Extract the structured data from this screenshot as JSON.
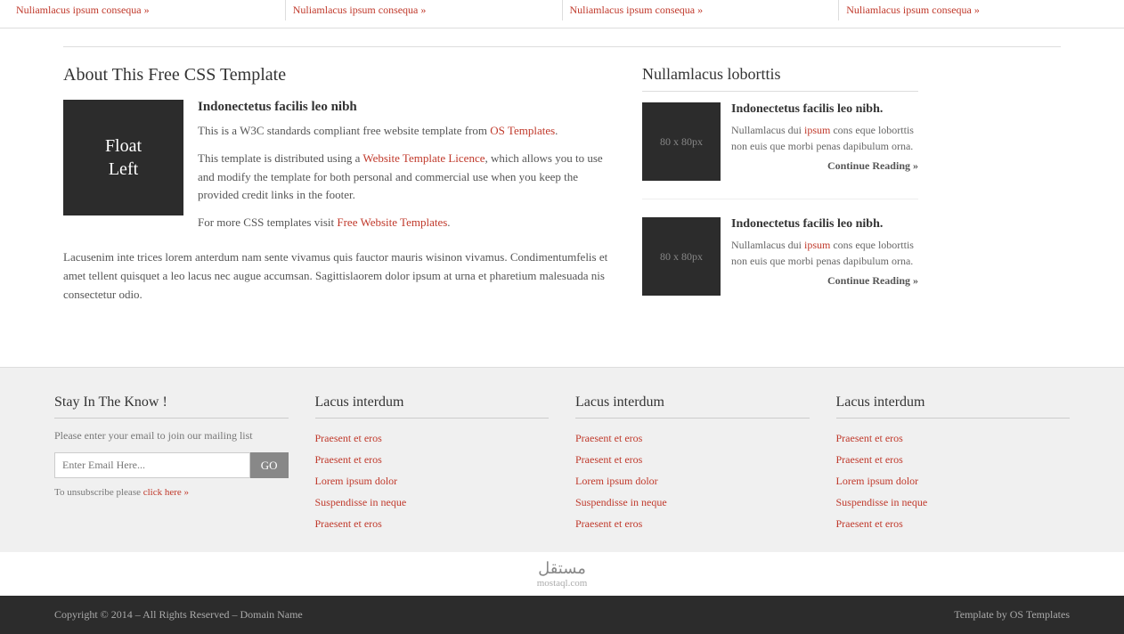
{
  "top_strip": {
    "items": [
      "Nuliamlacus ipsum consequa »",
      "Nuliamlacus ipsum consequa »",
      "Nuliamlacus ipsum consequa »",
      "Nuliamlacus ipsum consequa »"
    ]
  },
  "left_section": {
    "title": "About This Free CSS Template",
    "float_left": {
      "line1": "Float",
      "line2": "Left"
    },
    "article_title": "Indonectetus facilis leo nibh",
    "paragraph1": "This is a W3C standards compliant free website template from OS Templates.",
    "paragraph1_link1": "OS Templates",
    "paragraph2_before": "This template is distributed using a ",
    "paragraph2_link": "Website Template Licence",
    "paragraph2_after": ", which allows you to use and modify the template for both personal and commercial use when you keep the provided credit links in the footer.",
    "paragraph3_before": "For more CSS templates visit ",
    "paragraph3_link": "Free Website Templates",
    "paragraph3_after": ".",
    "main_text": "Lacusenim inte trices lorem anterdum nam sente vivamus quis fauctor mauris wisinon vivamus. Condimentumfelis et amet tellent quisquet a leo lacus nec augue accumsan. Sagittislaorem dolor ipsum at urna et pharetium malesuada nis consectetur odio."
  },
  "right_section": {
    "title": "Nullamlacus loborttis",
    "articles": [
      {
        "thumb": "80 x 80px",
        "title": "Indonectetus facilis leo nibh.",
        "text_before": "Nullamlacus dui ",
        "text_link": "ipsum",
        "text_after": " cons eque loborttis non euis que morbi penas dapibulum orna.",
        "continue": "Continue Reading »"
      },
      {
        "thumb": "80 x 80px",
        "title": "Indonectetus facilis leo nibh.",
        "text_before": "Nullamlacus dui ",
        "text_link": "ipsum",
        "text_after": " cons eque loborttis non euis que morbi penas dapibulum orna.",
        "continue": "Continue Reading »"
      }
    ]
  },
  "footer": {
    "col1": {
      "title": "Stay In The Know !",
      "desc": "Please enter your email to join our mailing list",
      "input_placeholder": "Enter Email Here...",
      "go_label": "GO",
      "unsubscribe_before": "To unsubscribe please ",
      "unsubscribe_link": "click here »"
    },
    "col2": {
      "title": "Lacus interdum",
      "links": [
        "Praesent et eros",
        "Praesent et eros",
        "Lorem ipsum dolor",
        "Suspendisse in neque",
        "Praesent et eros"
      ]
    },
    "col3": {
      "title": "Lacus interdum",
      "links": [
        "Praesent et eros",
        "Praesent et eros",
        "Lorem ipsum dolor",
        "Suspendisse in neque",
        "Praesent et eros"
      ]
    },
    "col4": {
      "title": "Lacus interdum",
      "links": [
        "Praesent et eros",
        "Praesent et eros",
        "Lorem ipsum dolor",
        "Suspendisse in neque",
        "Praesent et eros"
      ]
    },
    "bottom": {
      "copyright": "Copyright © 2014 – All Rights Reserved – Domain Name",
      "template_by": "Template by OS Templates",
      "watermark": "mostaql.com"
    }
  }
}
